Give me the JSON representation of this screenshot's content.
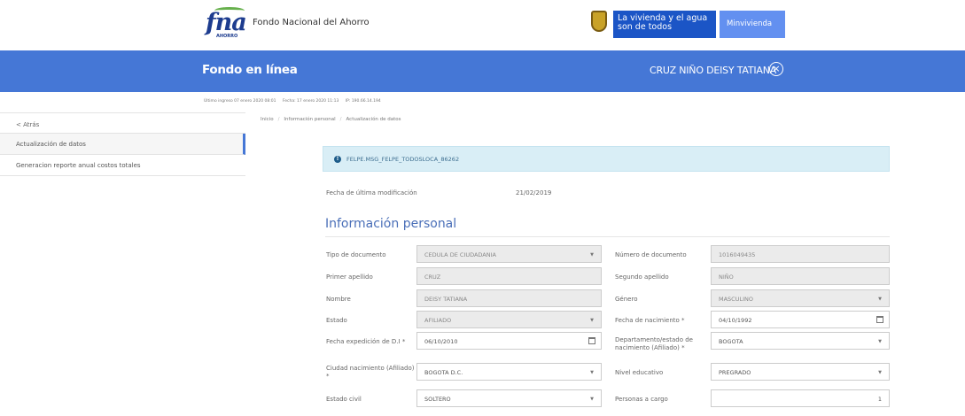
{
  "header": {
    "brand": {
      "logo_text": "fna",
      "logo_sub": "AHORRO",
      "name": "Fondo Nacional del Ahorro"
    },
    "gov": {
      "slogan_line1": "La vivienda y el agua",
      "slogan_line2": "son de todos",
      "ministry": "Minvivienda"
    }
  },
  "bluebar": {
    "title": "Fondo en línea",
    "user": "CRUZ NIÑO DEISY TATIANA",
    "close_symbol": "×"
  },
  "loginfo": {
    "last_login": "Último ingreso 07 enero 2020 08:01",
    "date": "Fecha: 17 enero 2020 11:13",
    "ip": "IP: 190.66.14.194"
  },
  "sidebar": {
    "back": "< Atrás",
    "items": [
      {
        "label": "Actualización de datos"
      },
      {
        "label": "Generacion reporte anual costos totales"
      }
    ]
  },
  "breadcrumb": [
    "Inicio",
    "Información personal",
    "Actualización de datos"
  ],
  "alert": {
    "message": "FELPE.MSG_FELPE_TODOSLOCA_86262"
  },
  "last_modified": {
    "label": "Fecha de última modificación",
    "value": "21/02/2019"
  },
  "section_title": "Información personal",
  "form": {
    "tipo_documento": {
      "label": "Tipo de documento",
      "value": "CEDULA DE CIUDADANIA"
    },
    "numero_documento": {
      "label": "Número de documento",
      "value": "1016049435"
    },
    "primer_apellido": {
      "label": "Primer apellido",
      "value": "CRUZ"
    },
    "segundo_apellido": {
      "label": "Segundo apellido",
      "value": "NIÑO"
    },
    "nombre": {
      "label": "Nombre",
      "value": "DEISY TATIANA"
    },
    "genero": {
      "label": "Género",
      "value": "MASCULINO"
    },
    "estado": {
      "label": "Estado",
      "value": "AFILIADO"
    },
    "fecha_nacimiento": {
      "label": "Fecha de nacimiento *",
      "value": "04/10/1992"
    },
    "fecha_expedicion": {
      "label": "Fecha expedición de D.I *",
      "value": "06/10/2010"
    },
    "departamento": {
      "label": "Departamento/estado de nacimiento (Afiliado) *",
      "value": "BOGOTA"
    },
    "ciudad": {
      "label": "Ciudad nacimiento (Afiliado) *",
      "value": "BOGOTA D.C."
    },
    "nivel_educativo": {
      "label": "Nivel educativo",
      "value": "PREGRADO"
    },
    "estado_civil": {
      "label": "Estado civil",
      "value": "SOLTERO"
    },
    "personas_cargo": {
      "label": "Personas a cargo",
      "value": "1"
    }
  }
}
